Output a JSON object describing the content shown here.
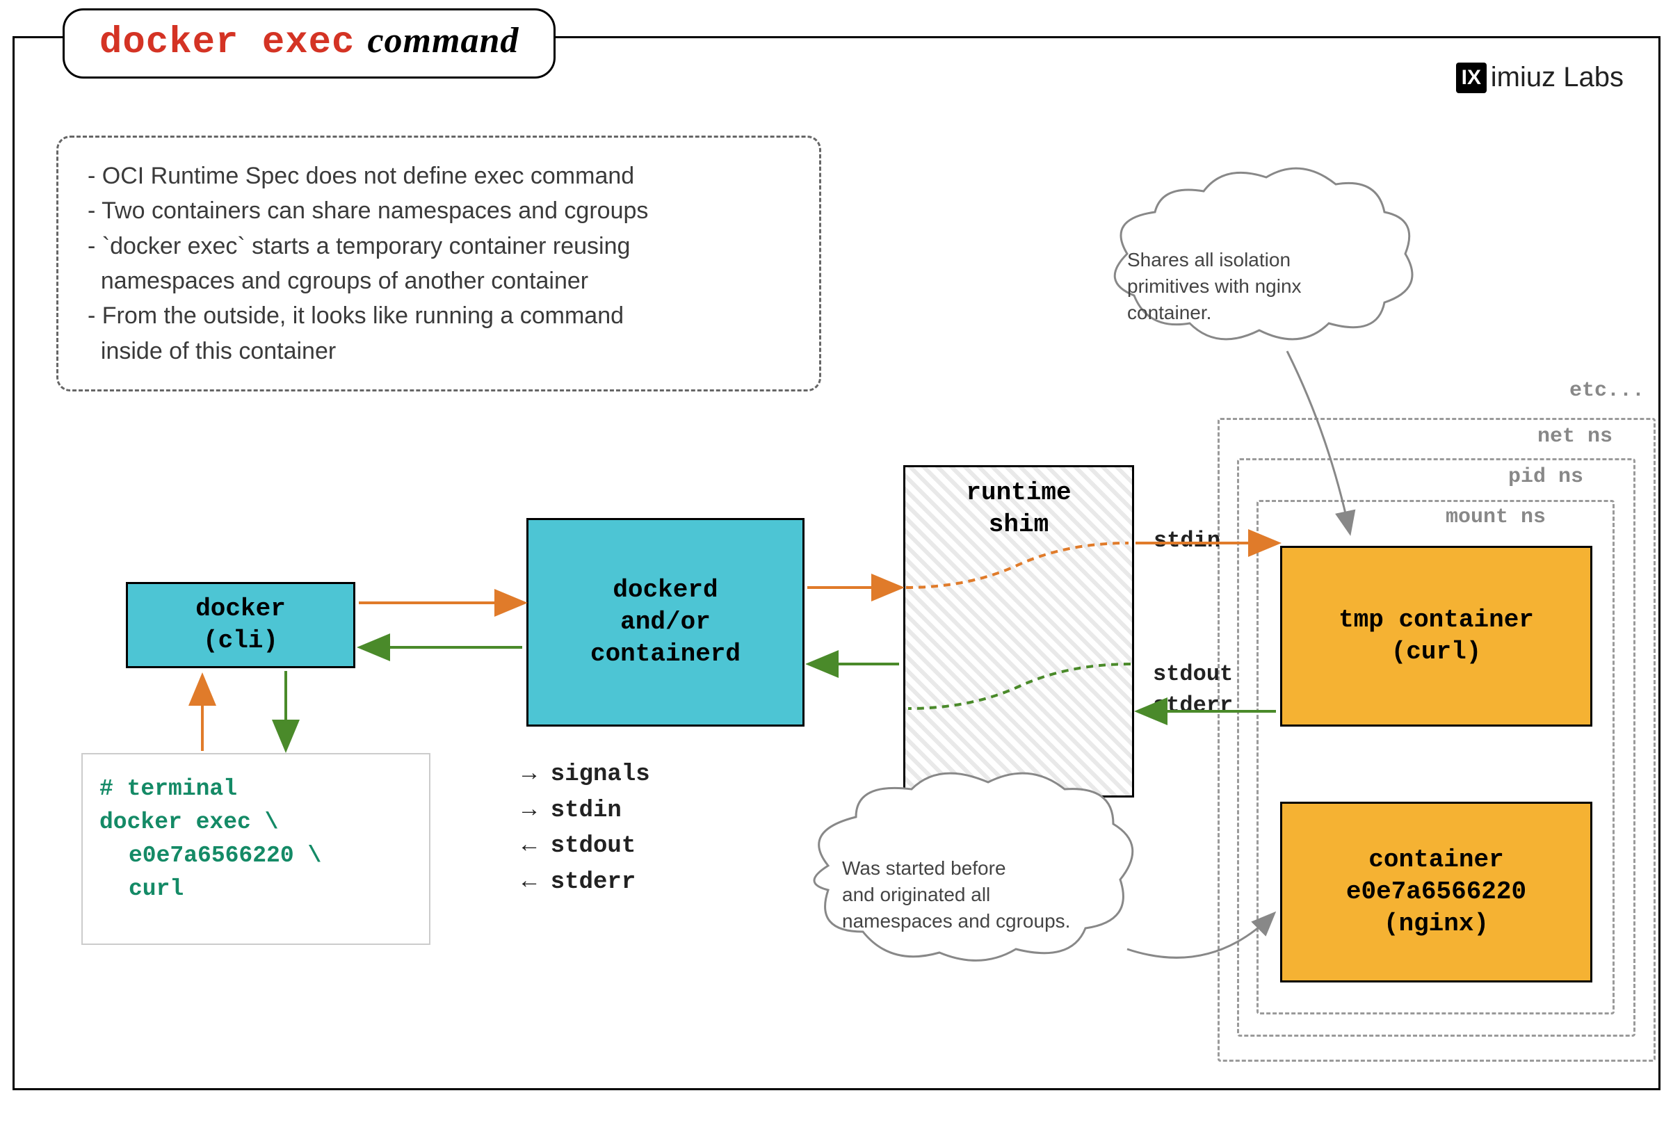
{
  "title": {
    "mono": "docker exec",
    "script": "command"
  },
  "brand": {
    "icon": "IX",
    "text": "imiuz Labs"
  },
  "notes": {
    "l1": "- OCI Runtime Spec does not define exec command",
    "l2": "- Two containers can share namespaces and cgroups",
    "l3a": "- `docker exec` starts a temporary container reusing",
    "l3b": "  namespaces and cgroups of another container",
    "l4a": "- From the outside, it looks like running a command",
    "l4b": "  inside of this container"
  },
  "boxes": {
    "docker_cli": "docker\n(cli)",
    "dockerd": "dockerd\nand/or\ncontainerd",
    "shim": "runtime\nshim",
    "tmp": "tmp container\n(curl)",
    "nginx": "container\ne0e7a6566220\n(nginx)"
  },
  "terminal": {
    "comment": "# terminal",
    "l1": "docker exec \\",
    "l2": "e0e7a6566220 \\",
    "l3": "curl"
  },
  "ns": {
    "mount": "mount ns",
    "pid": "pid ns",
    "net": "net ns",
    "etc": "etc..."
  },
  "io": {
    "stdin": "stdin",
    "stdout": "stdout",
    "stderr": "stderr",
    "signals": "signals"
  },
  "signals_list": {
    "l1": "→ signals",
    "l2": "→ stdin",
    "l3": "← stdout",
    "l4": "← stderr"
  },
  "clouds": {
    "top": "Shares all isolation\nprimitives with nginx\ncontainer.",
    "bot": "Was started before\nand originated all\nnamespaces and cgroups."
  },
  "colors": {
    "orange": "#e07b2a",
    "green": "#4a8a2a",
    "cyan": "#4dc5d4",
    "amber": "#f5b233",
    "gray": "#777"
  }
}
